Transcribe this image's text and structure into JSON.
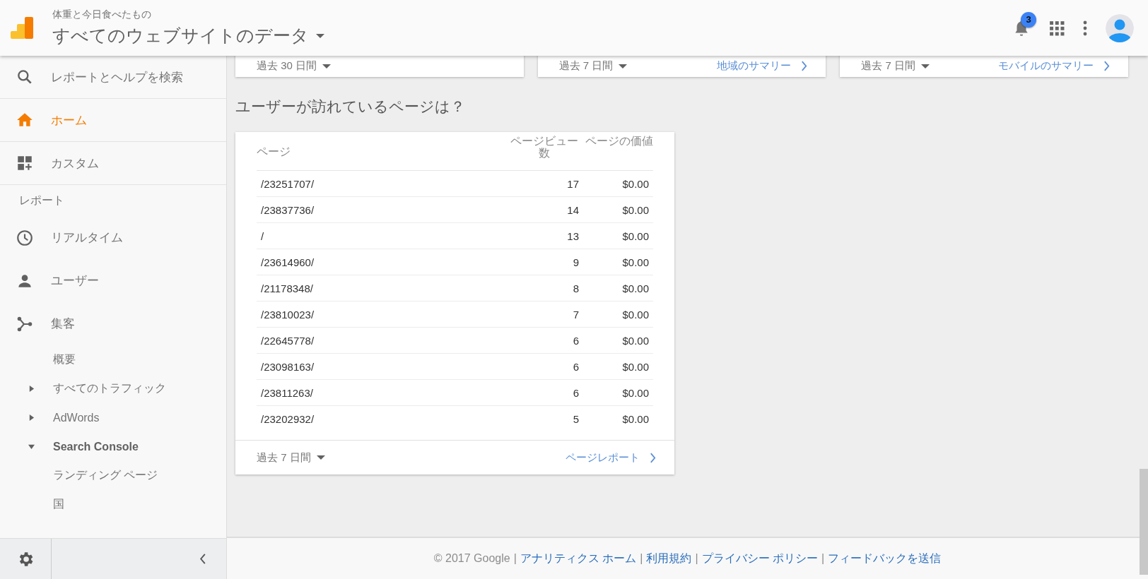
{
  "header": {
    "account": "体重と今日食べたもの",
    "property": "すべてのウェブサイトのデータ",
    "notifications": "3"
  },
  "sidebar": {
    "items": [
      {
        "kind": "search",
        "label": "レポートとヘルプを検索"
      },
      {
        "kind": "nav",
        "label": "ホーム",
        "selected": true
      },
      {
        "kind": "nav",
        "label": "カスタム",
        "selected": false
      },
      {
        "kind": "heading",
        "label": "レポート"
      },
      {
        "kind": "nav",
        "label": "リアルタイム",
        "selected": false
      },
      {
        "kind": "nav",
        "label": "ユーザー",
        "selected": false
      },
      {
        "kind": "nav",
        "label": "集客",
        "selected": false,
        "children": [
          {
            "label": "概要"
          },
          {
            "label": "すべてのトラフィック",
            "expanded": false
          },
          {
            "label": "AdWords",
            "expanded": false
          },
          {
            "label": "Search Console",
            "expanded": true,
            "children": [
              {
                "label": "ランディング ページ"
              },
              {
                "label": "国"
              }
            ]
          }
        ]
      }
    ]
  },
  "summary_cards": [
    {
      "range": "過去 30 日間"
    },
    {
      "range": "過去 7 日間",
      "link": "地域のサマリー"
    },
    {
      "range": "過去 7 日間",
      "link": "モバイルのサマリー"
    }
  ],
  "section_title": "ユーザーが訪れているページは？",
  "table": {
    "columns": [
      "ページ",
      "ページビュー数",
      "ページの価値"
    ],
    "rows": [
      [
        "/23251707/",
        "17",
        "$0.00"
      ],
      [
        "/23837736/",
        "14",
        "$0.00"
      ],
      [
        "/",
        "13",
        "$0.00"
      ],
      [
        "/23614960/",
        "9",
        "$0.00"
      ],
      [
        "/21178348/",
        "8",
        "$0.00"
      ],
      [
        "/23810023/",
        "7",
        "$0.00"
      ],
      [
        "/22645778/",
        "6",
        "$0.00"
      ],
      [
        "/23098163/",
        "6",
        "$0.00"
      ],
      [
        "/23811263/",
        "6",
        "$0.00"
      ],
      [
        "/23202932/",
        "5",
        "$0.00"
      ]
    ],
    "range": "過去 7 日間",
    "link": "ページレポート"
  },
  "footer": {
    "copyright": "© 2017 Google",
    "separator": "|",
    "links": [
      "アナリティクス ホーム",
      "利用規約",
      "プライバシー ポリシー",
      "フィードバックを送信"
    ]
  }
}
